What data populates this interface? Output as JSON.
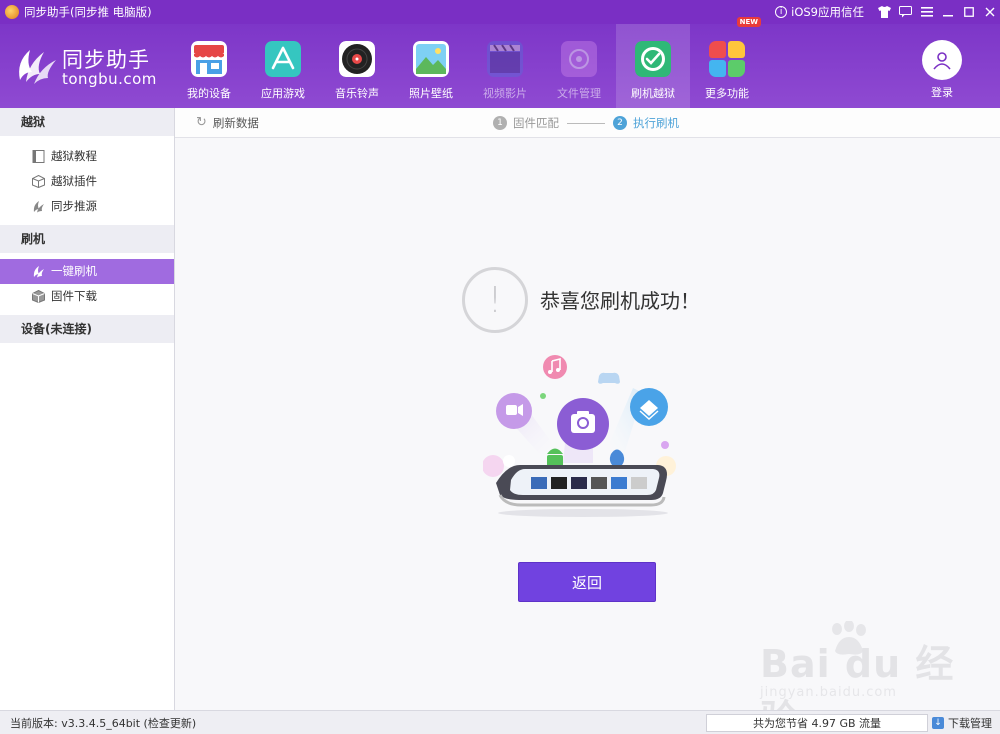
{
  "window": {
    "title": "同步助手(同步推 电脑版)",
    "ios_trust": "iOS9应用信任"
  },
  "logo": {
    "cn": "同步助手",
    "en": "tongbu.com"
  },
  "nav": {
    "items": [
      {
        "label": "我的设备"
      },
      {
        "label": "应用游戏"
      },
      {
        "label": "音乐铃声"
      },
      {
        "label": "照片壁纸"
      },
      {
        "label": "视频影片"
      },
      {
        "label": "文件管理"
      },
      {
        "label": "刷机越狱"
      },
      {
        "label": "更多功能",
        "badge": "NEW"
      }
    ],
    "login": "登录"
  },
  "sidebar": {
    "sections": [
      {
        "title": "越狱",
        "items": [
          {
            "label": "越狱教程"
          },
          {
            "label": "越狱插件"
          },
          {
            "label": "同步推源"
          }
        ]
      },
      {
        "title": "刷机",
        "items": [
          {
            "label": "一键刷机"
          },
          {
            "label": "固件下载"
          }
        ]
      },
      {
        "title": "设备(未连接)",
        "items": []
      }
    ]
  },
  "main": {
    "refresh": "刷新数据",
    "steps": [
      {
        "num": "1",
        "label": "固件匹配"
      },
      {
        "num": "2",
        "label": "执行刷机"
      }
    ],
    "success_mark": "!",
    "success_message": "恭喜您刷机成功！",
    "back_button": "返回"
  },
  "watermark": {
    "text": "Bai du 经验",
    "url": "jingyan.baidu.com"
  },
  "statusbar": {
    "version": "当前版本: v3.3.4.5_64bit  (检查更新)",
    "saved": "共为您节省  4.97 GB 流量",
    "download": "下载管理"
  },
  "colors": {
    "brand_purple": "#7a2fc4",
    "active_sidebar": "#a06be0",
    "button": "#7142e0",
    "step_active": "#4ea3d8"
  }
}
